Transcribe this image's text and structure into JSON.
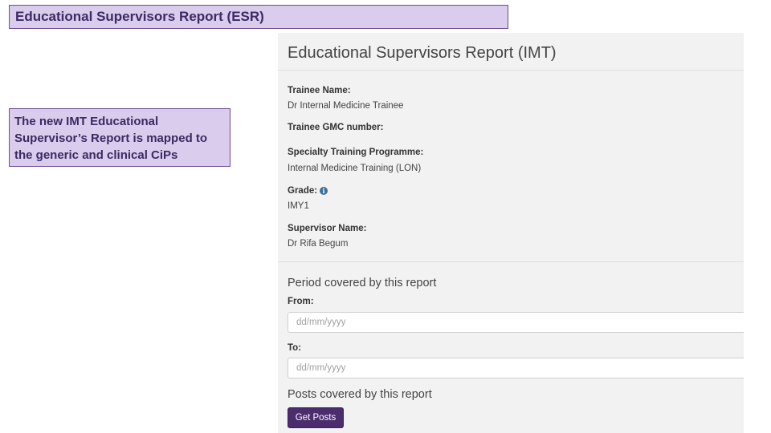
{
  "slide": {
    "title": "Educational Supervisors Report (ESR)",
    "note": "The new IMT Educational Supervisor’s Report is mapped to the generic and clinical CiPs"
  },
  "form": {
    "title": "Educational Supervisors Report (IMT)",
    "trainee_name_label": "Trainee Name:",
    "trainee_name_value": "Dr Internal Medicine Trainee",
    "gmc_label": "Trainee GMC number:",
    "programme_label": "Specialty Training Programme:",
    "programme_value": "Internal Medicine Training (LON)",
    "grade_label": "Grade:",
    "grade_icon": "info-icon",
    "grade_value": "IMY1",
    "supervisor_label": "Supervisor Name:",
    "supervisor_value": "Dr Rifa Begum",
    "period_heading": "Period covered by this report",
    "from_label": "From:",
    "from_placeholder": "dd/mm/yyyy",
    "to_label": "To:",
    "to_placeholder": "dd/mm/yyyy",
    "posts_heading": "Posts covered by this report",
    "get_posts_button": "Get Posts"
  },
  "colors": {
    "callout_bg": "#d9ccec",
    "callout_text": "#3c2a63",
    "button_bg": "#4b2c6d"
  }
}
